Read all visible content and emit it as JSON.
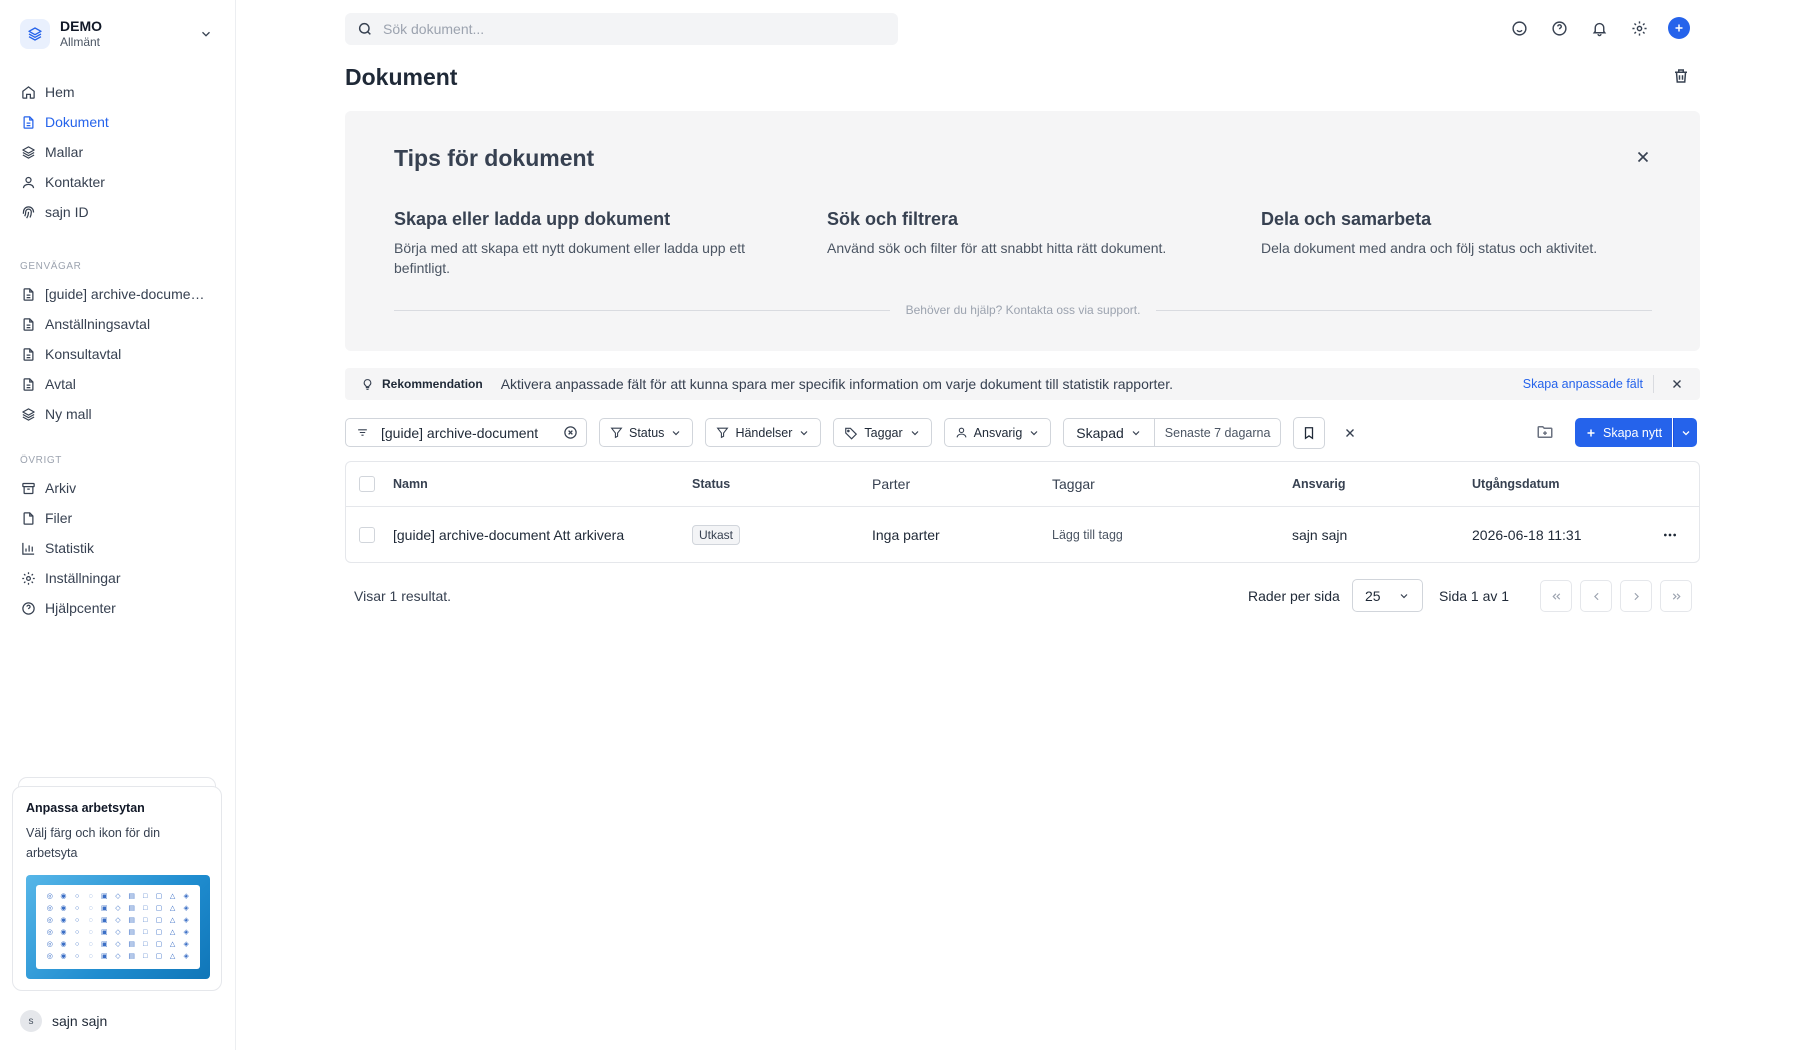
{
  "workspace": {
    "name": "DEMO",
    "subtitle": "Allmänt"
  },
  "nav": {
    "main": [
      {
        "label": "Hem",
        "icon": "home-icon"
      },
      {
        "label": "Dokument",
        "icon": "document-icon",
        "active": true
      },
      {
        "label": "Mallar",
        "icon": "layers-icon"
      },
      {
        "label": "Kontakter",
        "icon": "user-icon"
      },
      {
        "label": "sajn ID",
        "icon": "fingerprint-icon"
      }
    ],
    "shortcuts_title": "GENVÄGAR",
    "shortcuts": [
      {
        "label": "[guide] archive-docume…",
        "icon": "document-icon"
      },
      {
        "label": "Anställningsavtal",
        "icon": "document-icon"
      },
      {
        "label": "Konsultavtal",
        "icon": "document-icon"
      },
      {
        "label": "Avtal",
        "icon": "document-icon"
      },
      {
        "label": "Ny mall",
        "icon": "layers-icon"
      }
    ],
    "other_title": "ÖVRIGT",
    "other": [
      {
        "label": "Arkiv",
        "icon": "archive-icon"
      },
      {
        "label": "Filer",
        "icon": "file-icon"
      },
      {
        "label": "Statistik",
        "icon": "bar-chart-icon"
      },
      {
        "label": "Inställningar",
        "icon": "gear-icon"
      },
      {
        "label": "Hjälpcenter",
        "icon": "help-circle-icon"
      }
    ]
  },
  "promo": {
    "title": "Anpassa arbetsytan",
    "text": "Välj färg och ikon för din arbetsyta"
  },
  "user": {
    "initial": "s",
    "name": "sajn sajn"
  },
  "search": {
    "placeholder": "Sök dokument..."
  },
  "page_title": "Dokument",
  "tips": {
    "title": "Tips för dokument",
    "items": [
      {
        "heading": "Skapa eller ladda upp dokument",
        "text": "Börja med att skapa ett nytt dokument eller ladda upp ett befintligt."
      },
      {
        "heading": "Sök och filtrera",
        "text": "Använd sök och filter för att snabbt hitta rätt dokument."
      },
      {
        "heading": "Dela och samarbeta",
        "text": "Dela dokument med andra och följ status och aktivitet."
      }
    ],
    "help_text": "Behöver du hjälp? Kontakta oss via support."
  },
  "recommendation": {
    "label": "Rekommendation",
    "text": "Aktivera anpassade fält för att kunna spara mer specifik information om varje dokument till statistik rapporter.",
    "link": "Skapa anpassade fält"
  },
  "filters": {
    "search_value": "[guide] archive-document",
    "status": "Status",
    "events": "Händelser",
    "tags": "Taggar",
    "responsible": "Ansvarig",
    "created": "Skapad",
    "created_range": "Senaste 7 dagarna",
    "create_new": "Skapa nytt"
  },
  "table": {
    "columns": [
      "Namn",
      "Status",
      "Parter",
      "Taggar",
      "Ansvarig",
      "Utgångsdatum"
    ],
    "rows": [
      {
        "name": "[guide] archive-document Att arkivera",
        "status": "Utkast",
        "parties": "Inga parter",
        "tags": "Lägg till tagg",
        "responsible": "sajn sajn",
        "expiry": "2026-06-18 11:31"
      }
    ]
  },
  "pagination": {
    "results_text": "Visar 1 resultat.",
    "rows_per_page_label": "Rader per sida",
    "rows_per_page": "25",
    "page_info": "Sida 1 av 1"
  },
  "colors": {
    "accent": "#2563eb",
    "sidebar_border": "#eceef1",
    "card_bg": "#f5f5f6"
  }
}
